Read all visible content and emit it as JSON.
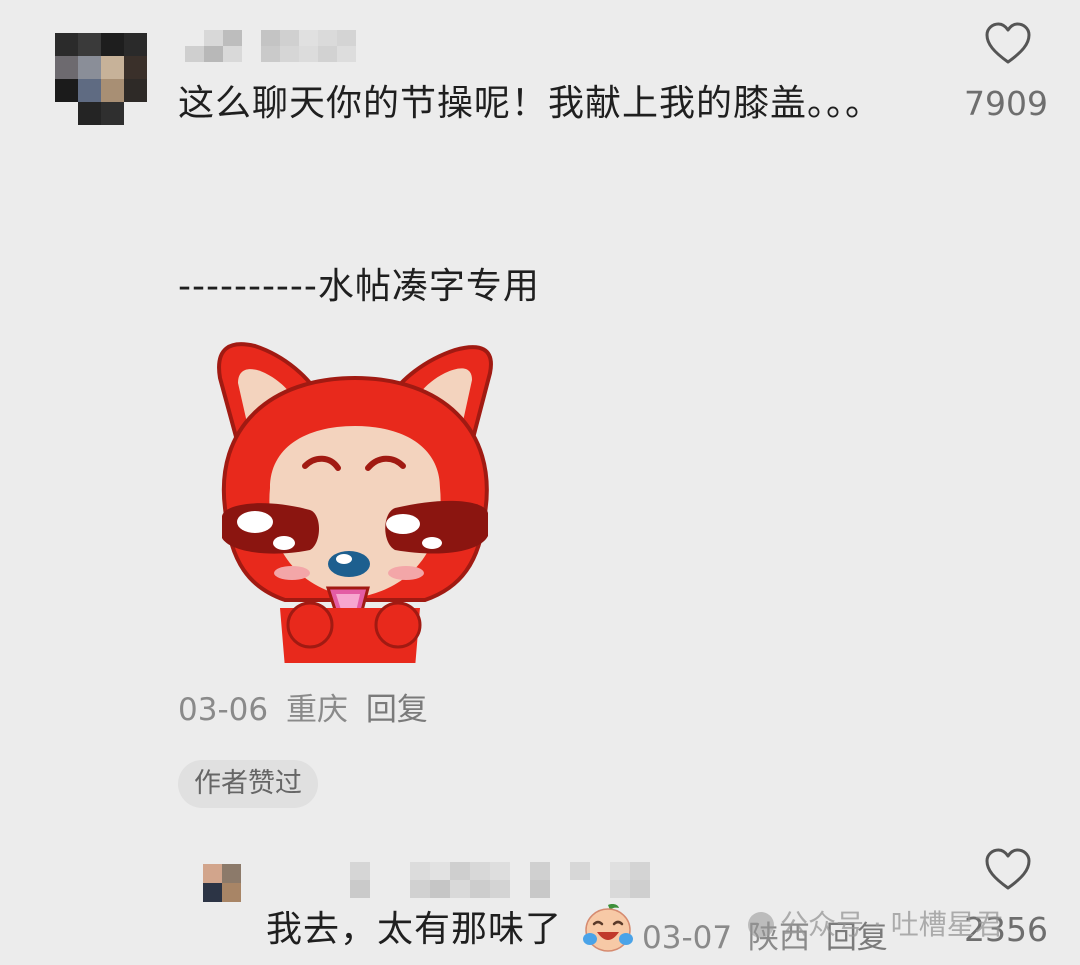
{
  "comments": [
    {
      "text": "这么聊天你的节操呢！我献上我的膝盖。。。",
      "likes": "7909",
      "body_extra": "----------水帖凑字专用",
      "sticker": "red-fox-crying-sticker",
      "date": "03-06",
      "location": "重庆",
      "reply_label": "回复",
      "badge": "作者赞过"
    },
    {
      "text": "我去，太有那味了",
      "emoji": "laughing-crying-emoji",
      "date": "03-07",
      "location": "陕西",
      "reply_label": "回复",
      "likes": "2356"
    }
  ],
  "watermark": "公众号 · 吐槽星君",
  "colors": {
    "background": "#ececec",
    "text": "#1f1f1f",
    "meta": "#8a8a8a",
    "sticker_red": "#e8291c"
  }
}
